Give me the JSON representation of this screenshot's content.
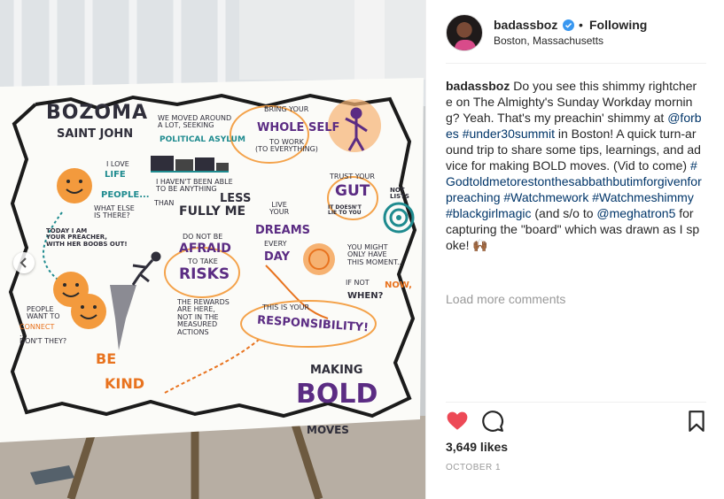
{
  "post": {
    "username": "badassboz",
    "follow_status": "Following",
    "location": "Boston, Massachusetts",
    "caption": {
      "author": "badassboz",
      "text_1": "Do you see this shimmy rightchere on The Almighty's Sunday Workday morning? Yeah. That's my preachin' shimmy at ",
      "mention_forbes": "@forbes",
      "hashtag_under30": "#under30summit",
      "text_2": " in Boston! A quick turn-around trip to share some tips, learnings, and advice for making BOLD moves. (Vid to come) ",
      "hashtag_god": "#Godtoldmetorestonthesabbathbutimforgivenforpreaching",
      "hashtag_watchmework": "#Watchmework",
      "hashtag_shimmy": "#Watchmeshimmy",
      "hashtag_bgm": "#blackgirlmagic",
      "text_3": " (and s/o to ",
      "mention_meghatron": "@meghatron5",
      "text_4": " for capturing the \"board\" which was drawn as I spoke! 🙌🏾"
    },
    "load_more": "Load more comments",
    "likes": "3,649 likes",
    "date": "OCTOBER 1"
  },
  "board": {
    "name_1": "BOZOMA",
    "name_2": "SAINT JOHN",
    "moved": "WE MOVED AROUND\nA LOT, SEEKING",
    "asylum": "POLITICAL ASYLUM",
    "whole_1": "BRING YOUR",
    "whole_2": "WHOLE SELF",
    "whole_3": "TO WORK\n(TO EVERYTHING)",
    "love_1": "I LOVE",
    "love_2": "LIFE",
    "love_3": "PEOPLE...",
    "love_4": "WHAT ELSE\nIS THERE?",
    "able_1": "I HAVEN'T BEEN ABLE\nTO BE ANYTHING",
    "able_2": "LESS",
    "able_3": "THAN",
    "able_4": "FULLY ME",
    "trust_1": "TRUST YOUR",
    "trust_2": "GUT",
    "trust_3": "IT DOESN'T\nLIE TO YOU",
    "lists": "NOT\nLISTS",
    "day_1": "TODAY I AM\nYOUR PREACHER,\nWITH HER BOOBS OUT!",
    "afraid_1": "DO NOT BE",
    "afraid_2": "AFRAID",
    "afraid_3": "TO TAKE",
    "afraid_4": "RISKS",
    "live_1": "LIVE\nYOUR",
    "live_2": "DREAMS",
    "live_3": "EVERY",
    "live_4": "DAY",
    "moment_1": "YOU MIGHT\nONLY HAVE\nTHIS MOMENT...",
    "moment_2": "IF NOT",
    "moment_3": "NOW,",
    "moment_4": "WHEN?",
    "people_1": "PEOPLE\nWANT TO",
    "people_2": "CONNECT",
    "people_3": "...\nDON'T THEY?",
    "rewards": "THE REWARDS\nARE HERE,\nNOT IN THE\nMEASURED\nACTIONS",
    "resp_1": "THIS IS YOUR",
    "resp_2": "RESPONSIBILITY!",
    "kind_1": "BE",
    "kind_2": "KIND",
    "bold_1": "MAKING",
    "bold_2": "BOLD",
    "bold_3": "MOVES"
  },
  "icons": {
    "prev": "chevron-left-icon",
    "verified": "verified-badge-icon",
    "heart": "heart-icon",
    "comment": "comment-icon",
    "bookmark": "bookmark-icon"
  },
  "colors": {
    "like_red": "#ed4956",
    "verified_blue": "#3897f0",
    "link_blue": "#003569",
    "muted_gray": "#999999"
  }
}
